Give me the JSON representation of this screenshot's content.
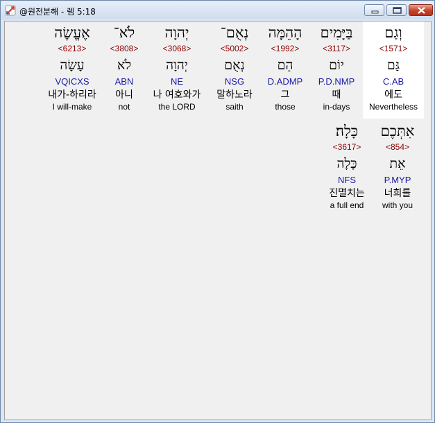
{
  "window": {
    "title": "@원전분해 - 렘 5:18",
    "icon": "app-icon"
  },
  "words": [
    {
      "hebrew": "וְגַם",
      "strong": "<1571>",
      "lemma": "גַּם",
      "morph": "C.AB",
      "korean": "에도",
      "english": "Nevertheless",
      "selected": true
    },
    {
      "hebrew": "בַּיָּמִים",
      "strong": "<3117>",
      "lemma": "יוֹם",
      "morph": "P.D.NMP",
      "korean": "때",
      "english": "in-days",
      "selected": false
    },
    {
      "hebrew": "הָהֵמָּה",
      "strong": "<1992>",
      "lemma": "הֵם",
      "morph": "D.ADMP",
      "korean": "그",
      "english": "those",
      "selected": false
    },
    {
      "hebrew": "נְאֻם־",
      "strong": "<5002>",
      "lemma": "נְאֻם",
      "morph": "NSG",
      "korean": "말하노라",
      "english": "saith",
      "selected": false
    },
    {
      "hebrew": "יְהוָה",
      "strong": "<3068>",
      "lemma": "יְהוָה",
      "morph": "NE",
      "korean": "나 여호와가",
      "english": "the LORD",
      "selected": false
    },
    {
      "hebrew": "לֹא־",
      "strong": "<3808>",
      "lemma": "לֹא",
      "morph": "ABN",
      "korean": "아니",
      "english": "not",
      "selected": false
    },
    {
      "hebrew": "אֶעֱשֶׂה",
      "strong": "<6213>",
      "lemma": "עָשָׂה",
      "morph": "VQICXS",
      "korean": "내가-하리라",
      "english": "I will-make",
      "selected": false
    },
    {
      "hebrew": "אִתְּכֶם",
      "strong": "<854>",
      "lemma": "אֵת",
      "morph": "P.MYP",
      "korean": "너희를",
      "english": "with you",
      "selected": false
    },
    {
      "hebrew": "כָּלָה׃",
      "strong": "<3617>",
      "lemma": "כָּלָה",
      "morph": "NFS",
      "korean": "진멸치는",
      "english": "a full end",
      "selected": false
    }
  ]
}
